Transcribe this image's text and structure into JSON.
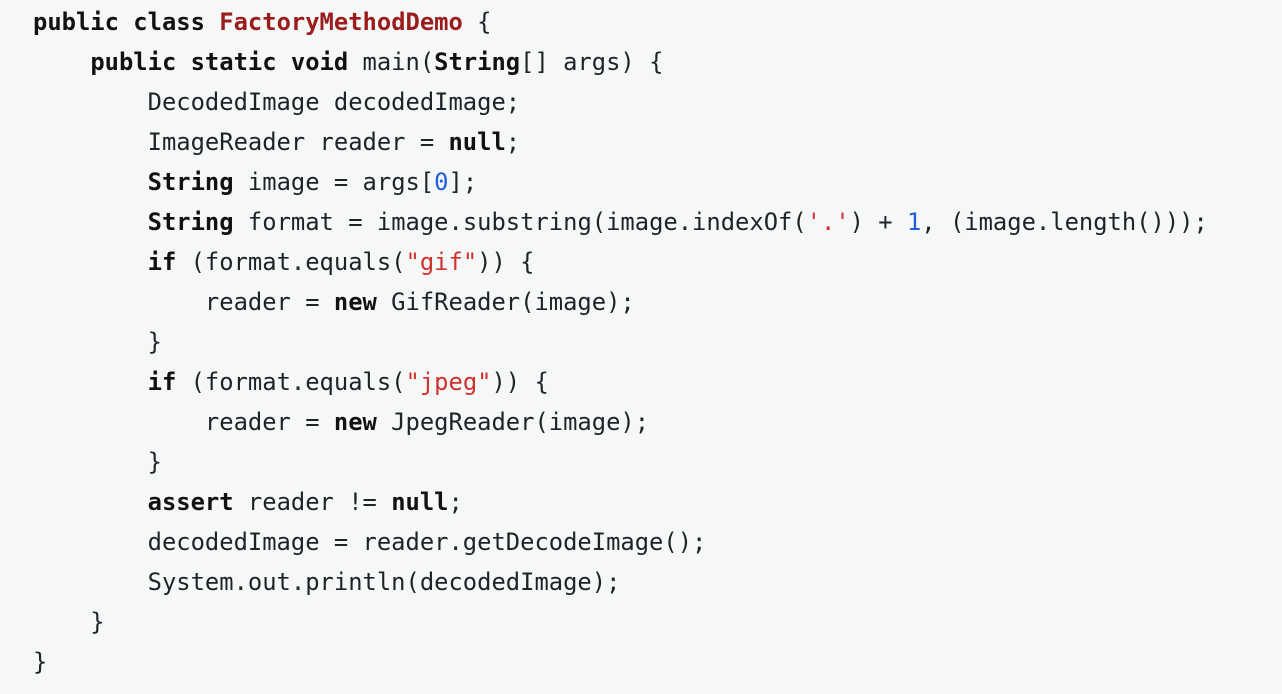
{
  "code": {
    "lines": [
      [
        {
          "t": "public class ",
          "c": "kw"
        },
        {
          "t": "FactoryMethodDemo",
          "c": "title"
        },
        {
          "t": " {",
          "c": ""
        }
      ],
      [
        {
          "t": "    ",
          "c": ""
        },
        {
          "t": "public static void ",
          "c": "kw"
        },
        {
          "t": "main(",
          "c": ""
        },
        {
          "t": "String",
          "c": "type"
        },
        {
          "t": "[] args) {",
          "c": ""
        }
      ],
      [
        {
          "t": "        DecodedImage decodedImage;",
          "c": ""
        }
      ],
      [
        {
          "t": "        ImageReader reader = ",
          "c": ""
        },
        {
          "t": "null",
          "c": "kw"
        },
        {
          "t": ";",
          "c": ""
        }
      ],
      [
        {
          "t": "        ",
          "c": ""
        },
        {
          "t": "String",
          "c": "type"
        },
        {
          "t": " image = args[",
          "c": ""
        },
        {
          "t": "0",
          "c": "num"
        },
        {
          "t": "];",
          "c": ""
        }
      ],
      [
        {
          "t": "        ",
          "c": ""
        },
        {
          "t": "String",
          "c": "type"
        },
        {
          "t": " format = image.substring(image.indexOf(",
          "c": ""
        },
        {
          "t": "'.'",
          "c": "str"
        },
        {
          "t": ") + ",
          "c": ""
        },
        {
          "t": "1",
          "c": "num"
        },
        {
          "t": ", (image.length()));",
          "c": ""
        }
      ],
      [
        {
          "t": "        ",
          "c": ""
        },
        {
          "t": "if",
          "c": "kw"
        },
        {
          "t": " (format.equals(",
          "c": ""
        },
        {
          "t": "\"gif\"",
          "c": "str"
        },
        {
          "t": ")) {",
          "c": ""
        }
      ],
      [
        {
          "t": "            reader = ",
          "c": ""
        },
        {
          "t": "new",
          "c": "kw"
        },
        {
          "t": " GifReader(image);",
          "c": ""
        }
      ],
      [
        {
          "t": "        }",
          "c": ""
        }
      ],
      [
        {
          "t": "        ",
          "c": ""
        },
        {
          "t": "if",
          "c": "kw"
        },
        {
          "t": " (format.equals(",
          "c": ""
        },
        {
          "t": "\"jpeg\"",
          "c": "str"
        },
        {
          "t": ")) {",
          "c": ""
        }
      ],
      [
        {
          "t": "            reader = ",
          "c": ""
        },
        {
          "t": "new",
          "c": "kw"
        },
        {
          "t": " JpegReader(image);",
          "c": ""
        }
      ],
      [
        {
          "t": "        }",
          "c": ""
        }
      ],
      [
        {
          "t": "        ",
          "c": ""
        },
        {
          "t": "assert",
          "c": "kw"
        },
        {
          "t": " reader != ",
          "c": ""
        },
        {
          "t": "null",
          "c": "kw"
        },
        {
          "t": ";",
          "c": ""
        }
      ],
      [
        {
          "t": "        decodedImage = reader.getDecodeImage();",
          "c": ""
        }
      ],
      [
        {
          "t": "        System.out.println(decodedImage);",
          "c": ""
        }
      ],
      [
        {
          "t": "    }",
          "c": ""
        }
      ],
      [
        {
          "t": "}",
          "c": ""
        }
      ]
    ]
  }
}
